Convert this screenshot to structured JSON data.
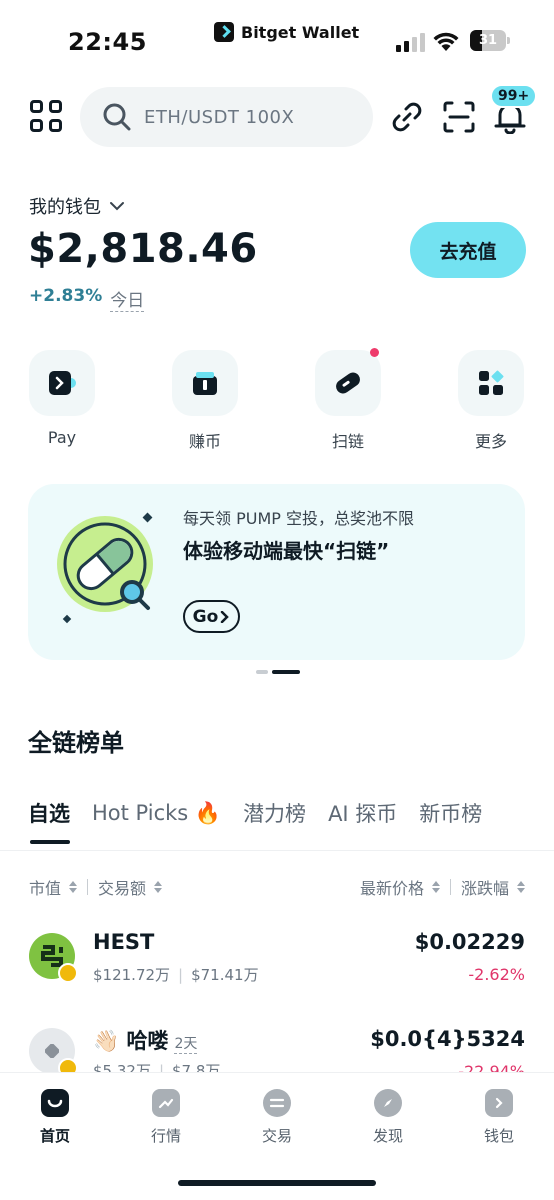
{
  "status_bar": {
    "time": "22:45",
    "app_brand": "Bitget Wallet",
    "battery": "31"
  },
  "header": {
    "search_placeholder": "ETH/USDT 100X",
    "notification_badge": "99+"
  },
  "wallet": {
    "label": "我的钱包",
    "balance": "$2,818.46",
    "change_pct": "+2.83%",
    "change_period": "今日",
    "deposit_label": "去充值"
  },
  "quick_actions": [
    {
      "label": "Pay",
      "icon": "pay-icon"
    },
    {
      "label": "赚币",
      "icon": "gift-icon"
    },
    {
      "label": "扫链",
      "icon": "pill-scan-icon"
    },
    {
      "label": "更多",
      "icon": "more-grid-icon"
    }
  ],
  "promo": {
    "subtitle": "每天领 PUMP 空投，总奖池不限",
    "title": "体验移动端最快“扫链”",
    "go_label": "Go"
  },
  "ranking": {
    "title": "全链榜单",
    "tabs": [
      "自选",
      "Hot Picks 🔥",
      "潜力榜",
      "AI 探币",
      "新币榜"
    ],
    "columns": {
      "market_cap": "市值",
      "volume": "交易额",
      "latest_price": "最新价格",
      "change": "涨跌幅"
    },
    "rows": [
      {
        "name": "HEST",
        "market_cap": "$121.72万",
        "volume": "$71.41万",
        "price": "$0.02229",
        "change": "-2.62%"
      },
      {
        "name": "👋🏻 哈喽",
        "age": "2天",
        "market_cap": "$5.32万",
        "volume": "$7.8万",
        "price": "$0.0{4}5324",
        "change": "-22.94%"
      }
    ]
  },
  "bottom_nav": [
    {
      "label": "首页",
      "icon": "home-icon",
      "active": true
    },
    {
      "label": "行情",
      "icon": "market-icon",
      "active": false
    },
    {
      "label": "交易",
      "icon": "swap-icon",
      "active": false
    },
    {
      "label": "发现",
      "icon": "discover-icon",
      "active": false
    },
    {
      "label": "钱包",
      "icon": "wallet-icon",
      "active": false
    }
  ],
  "colors": {
    "accent": "#73e2f1",
    "positive": "#2f7f95",
    "negative": "#e0356a",
    "text": "#0f1b24"
  }
}
